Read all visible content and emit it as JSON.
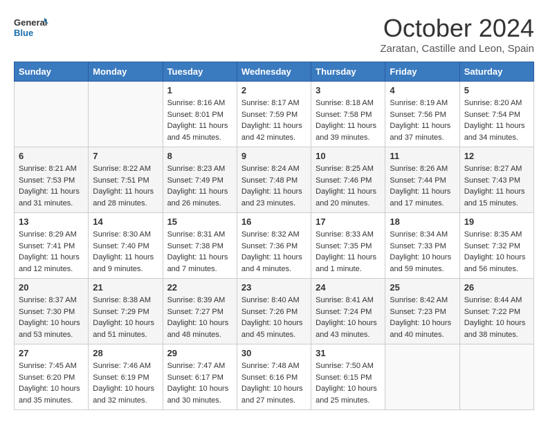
{
  "header": {
    "logo_line1": "General",
    "logo_line2": "Blue",
    "month": "October 2024",
    "location": "Zaratan, Castille and Leon, Spain"
  },
  "weekdays": [
    "Sunday",
    "Monday",
    "Tuesday",
    "Wednesday",
    "Thursday",
    "Friday",
    "Saturday"
  ],
  "weeks": [
    [
      {
        "day": "",
        "detail": ""
      },
      {
        "day": "",
        "detail": ""
      },
      {
        "day": "1",
        "detail": "Sunrise: 8:16 AM\nSunset: 8:01 PM\nDaylight: 11 hours and 45 minutes."
      },
      {
        "day": "2",
        "detail": "Sunrise: 8:17 AM\nSunset: 7:59 PM\nDaylight: 11 hours and 42 minutes."
      },
      {
        "day": "3",
        "detail": "Sunrise: 8:18 AM\nSunset: 7:58 PM\nDaylight: 11 hours and 39 minutes."
      },
      {
        "day": "4",
        "detail": "Sunrise: 8:19 AM\nSunset: 7:56 PM\nDaylight: 11 hours and 37 minutes."
      },
      {
        "day": "5",
        "detail": "Sunrise: 8:20 AM\nSunset: 7:54 PM\nDaylight: 11 hours and 34 minutes."
      }
    ],
    [
      {
        "day": "6",
        "detail": "Sunrise: 8:21 AM\nSunset: 7:53 PM\nDaylight: 11 hours and 31 minutes."
      },
      {
        "day": "7",
        "detail": "Sunrise: 8:22 AM\nSunset: 7:51 PM\nDaylight: 11 hours and 28 minutes."
      },
      {
        "day": "8",
        "detail": "Sunrise: 8:23 AM\nSunset: 7:49 PM\nDaylight: 11 hours and 26 minutes."
      },
      {
        "day": "9",
        "detail": "Sunrise: 8:24 AM\nSunset: 7:48 PM\nDaylight: 11 hours and 23 minutes."
      },
      {
        "day": "10",
        "detail": "Sunrise: 8:25 AM\nSunset: 7:46 PM\nDaylight: 11 hours and 20 minutes."
      },
      {
        "day": "11",
        "detail": "Sunrise: 8:26 AM\nSunset: 7:44 PM\nDaylight: 11 hours and 17 minutes."
      },
      {
        "day": "12",
        "detail": "Sunrise: 8:27 AM\nSunset: 7:43 PM\nDaylight: 11 hours and 15 minutes."
      }
    ],
    [
      {
        "day": "13",
        "detail": "Sunrise: 8:29 AM\nSunset: 7:41 PM\nDaylight: 11 hours and 12 minutes."
      },
      {
        "day": "14",
        "detail": "Sunrise: 8:30 AM\nSunset: 7:40 PM\nDaylight: 11 hours and 9 minutes."
      },
      {
        "day": "15",
        "detail": "Sunrise: 8:31 AM\nSunset: 7:38 PM\nDaylight: 11 hours and 7 minutes."
      },
      {
        "day": "16",
        "detail": "Sunrise: 8:32 AM\nSunset: 7:36 PM\nDaylight: 11 hours and 4 minutes."
      },
      {
        "day": "17",
        "detail": "Sunrise: 8:33 AM\nSunset: 7:35 PM\nDaylight: 11 hours and 1 minute."
      },
      {
        "day": "18",
        "detail": "Sunrise: 8:34 AM\nSunset: 7:33 PM\nDaylight: 10 hours and 59 minutes."
      },
      {
        "day": "19",
        "detail": "Sunrise: 8:35 AM\nSunset: 7:32 PM\nDaylight: 10 hours and 56 minutes."
      }
    ],
    [
      {
        "day": "20",
        "detail": "Sunrise: 8:37 AM\nSunset: 7:30 PM\nDaylight: 10 hours and 53 minutes."
      },
      {
        "day": "21",
        "detail": "Sunrise: 8:38 AM\nSunset: 7:29 PM\nDaylight: 10 hours and 51 minutes."
      },
      {
        "day": "22",
        "detail": "Sunrise: 8:39 AM\nSunset: 7:27 PM\nDaylight: 10 hours and 48 minutes."
      },
      {
        "day": "23",
        "detail": "Sunrise: 8:40 AM\nSunset: 7:26 PM\nDaylight: 10 hours and 45 minutes."
      },
      {
        "day": "24",
        "detail": "Sunrise: 8:41 AM\nSunset: 7:24 PM\nDaylight: 10 hours and 43 minutes."
      },
      {
        "day": "25",
        "detail": "Sunrise: 8:42 AM\nSunset: 7:23 PM\nDaylight: 10 hours and 40 minutes."
      },
      {
        "day": "26",
        "detail": "Sunrise: 8:44 AM\nSunset: 7:22 PM\nDaylight: 10 hours and 38 minutes."
      }
    ],
    [
      {
        "day": "27",
        "detail": "Sunrise: 7:45 AM\nSunset: 6:20 PM\nDaylight: 10 hours and 35 minutes."
      },
      {
        "day": "28",
        "detail": "Sunrise: 7:46 AM\nSunset: 6:19 PM\nDaylight: 10 hours and 32 minutes."
      },
      {
        "day": "29",
        "detail": "Sunrise: 7:47 AM\nSunset: 6:17 PM\nDaylight: 10 hours and 30 minutes."
      },
      {
        "day": "30",
        "detail": "Sunrise: 7:48 AM\nSunset: 6:16 PM\nDaylight: 10 hours and 27 minutes."
      },
      {
        "day": "31",
        "detail": "Sunrise: 7:50 AM\nSunset: 6:15 PM\nDaylight: 10 hours and 25 minutes."
      },
      {
        "day": "",
        "detail": ""
      },
      {
        "day": "",
        "detail": ""
      }
    ]
  ]
}
